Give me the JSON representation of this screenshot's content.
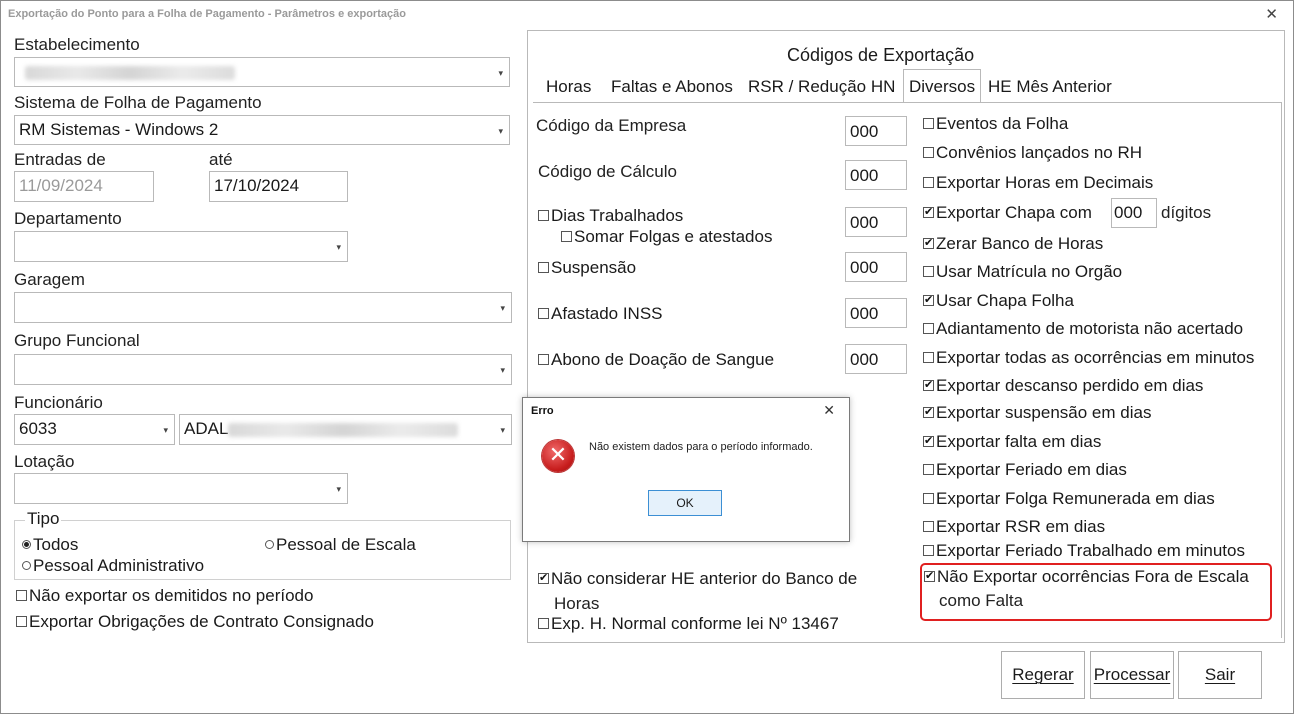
{
  "window": {
    "title": "Exportação do Ponto para a Folha de Pagamento - Parâmetros e exportação"
  },
  "form": {
    "estabelecimento_label": "Estabelecimento",
    "sistema_label": "Sistema de Folha de Pagamento",
    "sistema_value": "RM Sistemas - Windows 2",
    "entradas_label": "Entradas de",
    "entradas_value": "11/09/2024",
    "ate_label": "até",
    "ate_value": "17/10/2024",
    "departamento_label": "Departamento",
    "garagem_label": "Garagem",
    "grupo_label": "Grupo Funcional",
    "funcionario_label": "Funcionário",
    "funcionario_code": "6033",
    "funcionario_name": "ADAL",
    "lotacao_label": "Lotação",
    "tipo_label": "Tipo",
    "radio_todos": "Todos",
    "radio_escala": "Pessoal de Escala",
    "radio_admin": "Pessoal Administrativo",
    "chk_demitidos": "Não exportar os demitidos no período",
    "chk_obrigacoes": "Exportar Obrigações de Contrato Consignado"
  },
  "panel": {
    "title": "Códigos de Exportação",
    "tabs": [
      "Horas",
      "Faltas e Abonos",
      "RSR / Redução HN",
      "Diversos",
      "HE Mês Anterior"
    ],
    "codigo_empresa_label": "Código da Empresa",
    "codigo_empresa_value": "000",
    "codigo_calculo_label": "Código de Cálculo",
    "codigo_calculo_value": "000",
    "dias_trabalhados_label": "Dias Trabalhados",
    "dias_trabalhados_value": "000",
    "somar_folgas_label": "Somar Folgas e atestados",
    "suspensao_label": "Suspensão",
    "suspensao_value": "000",
    "afastado_label": "Afastado INSS",
    "afastado_value": "000",
    "abono_label": "Abono de Doação de Sangue",
    "abono_value": "000",
    "nao_considerar_label": "Não considerar HE anterior do Banco de",
    "nao_considerar_label2": "Horas",
    "exp_normal_label": "Exp. H. Normal conforme lei Nº 13467",
    "right_checks": [
      "Eventos da Folha",
      "Convênios lançados no RH",
      "Exportar Horas em Decimais",
      "Exportar Chapa com",
      "Zerar Banco de Horas",
      "Usar Matrícula no Orgão",
      "Usar Chapa Folha",
      "Adiantamento de motorista não acertado",
      "Exportar todas as ocorrências em minutos",
      "Exportar descanso perdido em dias",
      "Exportar suspensão em dias",
      "Exportar falta em dias",
      "Exportar Feriado em dias",
      "Exportar Folga Remunerada em dias",
      "Exportar RSR em dias",
      "Exportar Feriado Trabalhado em minutos"
    ],
    "chapa_digits_value": "000",
    "chapa_digits_suffix": "dígitos",
    "highlight_line1": "Não Exportar ocorrências Fora de Escala",
    "highlight_line2": "como Falta"
  },
  "buttons": {
    "regerar": "Regerar",
    "processar": "Processar",
    "sair": "Sair"
  },
  "dialog": {
    "title": "Erro",
    "message": "Não existem dados para o período informado.",
    "ok": "OK"
  }
}
